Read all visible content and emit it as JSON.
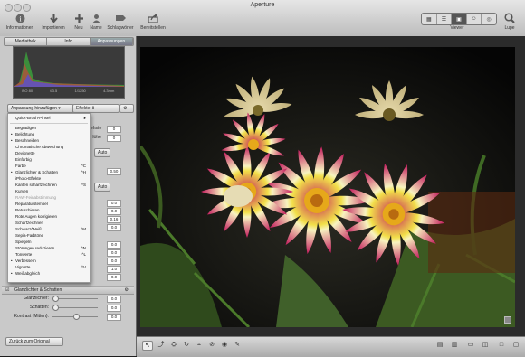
{
  "window": {
    "title": "Aperture"
  },
  "toolbar": {
    "buttons": [
      {
        "label": "Informationen",
        "icon": "info-icon"
      },
      {
        "label": "Importieren",
        "icon": "import-icon"
      },
      {
        "label": "Neu",
        "icon": "plus-icon"
      },
      {
        "label": "Name",
        "icon": "person-icon"
      },
      {
        "label": "Schlagwörter",
        "icon": "tag-icon"
      },
      {
        "label": "Bereitstellen",
        "icon": "share-icon"
      }
    ],
    "viewer_label": "Viewer",
    "loupe_label": "Lupe"
  },
  "inspector": {
    "tabs": [
      "Mediathek",
      "Info",
      "Anpassungen"
    ],
    "active_tab": "Anpassungen",
    "histogram_info": [
      "ISO 80",
      "f/3.5",
      "1/1250",
      "4.3mm"
    ],
    "add_adjustment_label": "Anpassung hinzufügen",
    "effects_label": "Effekte",
    "values": {
      "c1": "0",
      "c2": "0",
      "auto1": "Auto",
      "c3": "0.50",
      "auto2": "Auto"
    },
    "side_labels": {
      "haeste": "ehste",
      "hohe": "Höhe"
    },
    "dim_values": [
      "0.0",
      "0.0",
      "0.16",
      "0.0",
      "0.0",
      "0.0",
      "0.0",
      "1.0",
      "0.0"
    ],
    "highlights_section": "Glanzlichter & Schatten",
    "rows": [
      {
        "label": "Glanzlichter:",
        "value": "0.0"
      },
      {
        "label": "Schatten:",
        "value": "0.0"
      },
      {
        "label": "Kontrast (Mitten):",
        "value": "0.0"
      }
    ],
    "reset_button": "Zurück zum Original"
  },
  "menu": {
    "items": [
      {
        "label": "Quick-Brush-Pinsel",
        "shortcut": "▸",
        "dot": "",
        "state": "normal"
      },
      {
        "sep": true
      },
      {
        "label": "Begradigen",
        "shortcut": "",
        "dot": "",
        "state": "normal"
      },
      {
        "label": "Belichtung",
        "shortcut": "",
        "dot": "•",
        "state": "normal"
      },
      {
        "label": "Beschneiden",
        "shortcut": "",
        "dot": "•",
        "state": "normal"
      },
      {
        "label": "Chromatische Abweichung",
        "shortcut": "",
        "dot": "",
        "state": "normal"
      },
      {
        "label": "Devignette",
        "shortcut": "",
        "dot": "",
        "state": "normal"
      },
      {
        "label": "Einfarbig",
        "shortcut": "",
        "dot": "",
        "state": "normal"
      },
      {
        "label": "Farbe",
        "shortcut": "^C",
        "dot": "",
        "state": "normal"
      },
      {
        "label": "Glanzlichter & Schatten",
        "shortcut": "^H",
        "dot": "•",
        "state": "normal"
      },
      {
        "label": "iPhoto-Effekte",
        "shortcut": "",
        "dot": "",
        "state": "normal"
      },
      {
        "label": "Kanten scharfzeichnen",
        "shortcut": "^S",
        "dot": "",
        "state": "normal"
      },
      {
        "label": "Kurven",
        "shortcut": "",
        "dot": "",
        "state": "normal"
      },
      {
        "label": "RAW-Feinabstimmung",
        "shortcut": "",
        "dot": "",
        "state": "dis"
      },
      {
        "label": "Reparaturstempel",
        "shortcut": "",
        "dot": "",
        "state": "normal"
      },
      {
        "label": "Retuschieren",
        "shortcut": "",
        "dot": "",
        "state": "normal"
      },
      {
        "label": "Rote Augen korrigieren",
        "shortcut": "",
        "dot": "",
        "state": "normal"
      },
      {
        "label": "Scharfzeichnen",
        "shortcut": "",
        "dot": "",
        "state": "normal"
      },
      {
        "label": "Schwarz/Weiß",
        "shortcut": "^M",
        "dot": "",
        "state": "normal"
      },
      {
        "label": "Sepia-Farbtöne",
        "shortcut": "",
        "dot": "",
        "state": "normal"
      },
      {
        "label": "Spiegeln",
        "shortcut": "",
        "dot": "",
        "state": "normal"
      },
      {
        "label": "Störungen reduzieren",
        "shortcut": "^N",
        "dot": "",
        "state": "normal"
      },
      {
        "label": "Tonwerte",
        "shortcut": "^L",
        "dot": "",
        "state": "normal"
      },
      {
        "label": "Verbessern",
        "shortcut": "",
        "dot": "•",
        "state": "normal"
      },
      {
        "label": "Vignette",
        "shortcut": "^V",
        "dot": "",
        "state": "normal"
      },
      {
        "label": "Weißabgleich",
        "shortcut": "",
        "dot": "•",
        "state": "normal"
      }
    ]
  },
  "colors": {
    "accent": "#3875d7",
    "petal_pink": "#c2185b",
    "petal_yellow": "#f2df4a"
  }
}
